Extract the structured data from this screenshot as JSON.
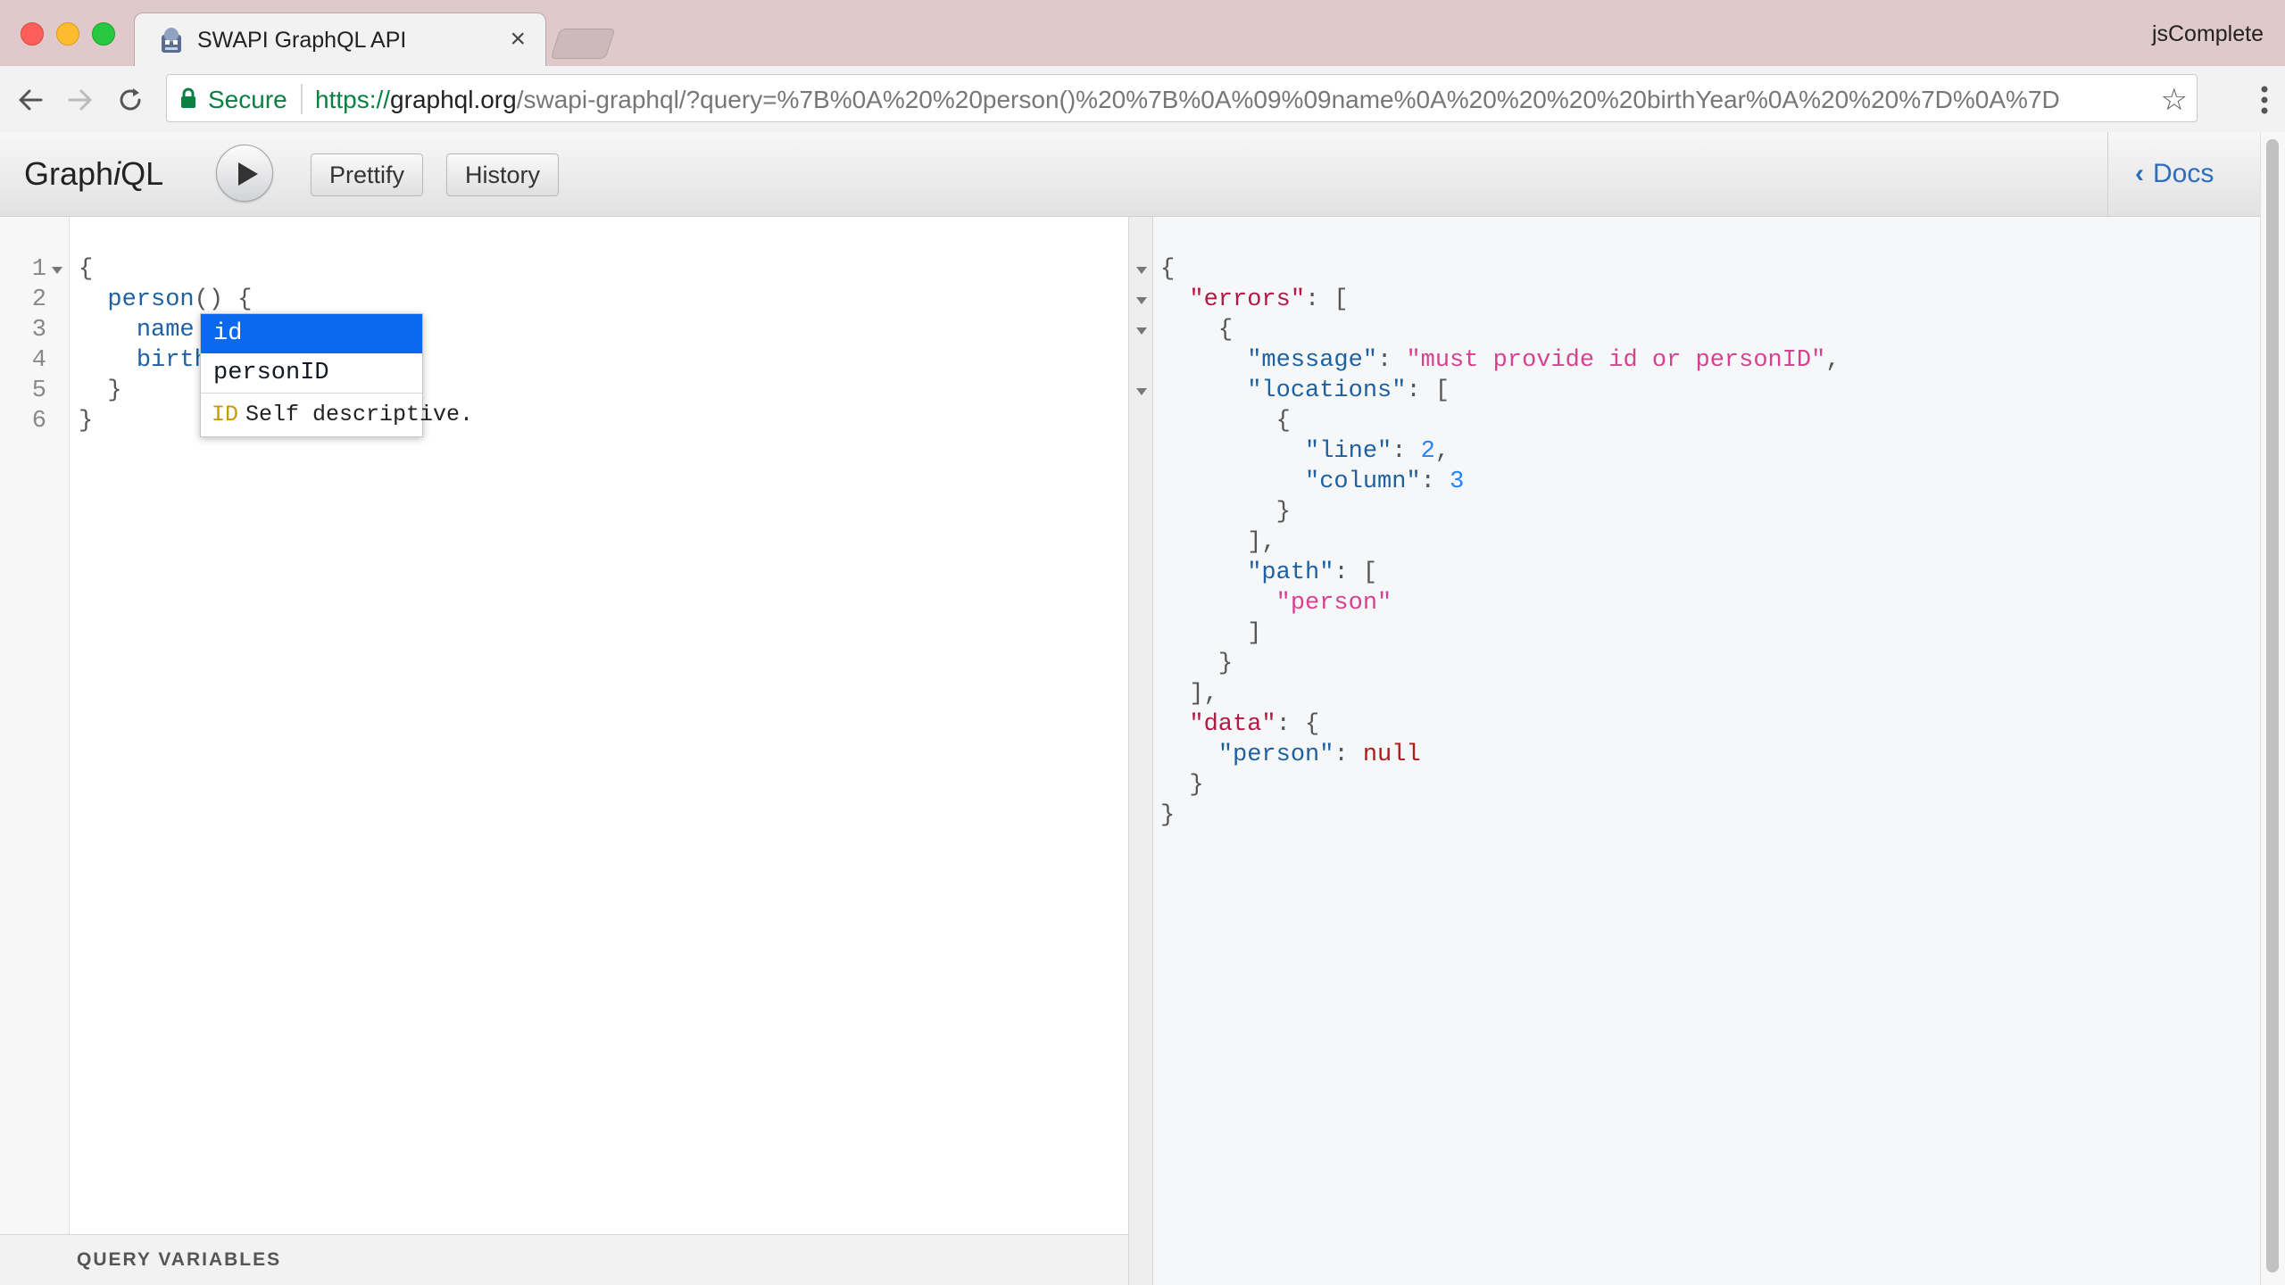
{
  "window": {
    "tab_title": "SWAPI GraphQL API",
    "tab_close": "×",
    "profile": "jsComplete"
  },
  "address_bar": {
    "secure_label": "Secure",
    "url_scheme": "https://",
    "url_host": "graphql.org",
    "url_path": "/swapi-graphql/?query=%7B%0A%20%20person()%20%7B%0A%09%09name%0A%20%20%20%20birthYear%0A%20%20%7D%0A%7D",
    "star": "☆"
  },
  "graphiql": {
    "logo_pre": "Graph",
    "logo_i": "i",
    "logo_post": "QL",
    "prettify": "Prettify",
    "history": "History",
    "docs": "Docs",
    "docs_chevron": "‹",
    "query_variables": "QUERY VARIABLES"
  },
  "editor": {
    "line_numbers": [
      "1",
      "2",
      "3",
      "4",
      "5",
      "6"
    ],
    "lines": {
      "l1": "{",
      "l2_indent": "  ",
      "l2_field": "person",
      "l2_parens": "() ",
      "l2_brace": "{",
      "l3_indent": "    ",
      "l3_field": "name",
      "l4_indent": "    ",
      "l4_field": "birth",
      "l5": "  }",
      "l6": "}"
    }
  },
  "autocomplete": {
    "items": [
      "id",
      "personID"
    ],
    "selected_index": 0,
    "info_type": "ID",
    "info_text": "Self descriptive."
  },
  "result": {
    "open": "{",
    "errors_key": "\"errors\"",
    "colon_bracket": ": [",
    "obj_open": "{",
    "message_key": "\"message\"",
    "message_val": "\"must provide id or personID\"",
    "locations_key": "\"locations\"",
    "loc_open": "{",
    "line_key": "\"line\"",
    "line_val": "2",
    "column_key": "\"column\"",
    "column_val": "3",
    "loc_close": "}",
    "arr_close_comma": "],",
    "path_key": "\"path\"",
    "path_val": "\"person\"",
    "arr_close": "]",
    "obj_close": "}",
    "errors_close": "],",
    "data_key": "\"data\"",
    "colon_brace": ": {",
    "person_key": "\"person\"",
    "person_val": "null",
    "data_close": "}",
    "close": "}"
  }
}
